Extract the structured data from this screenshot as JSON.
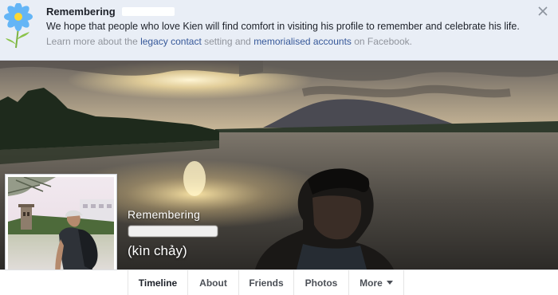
{
  "banner": {
    "title": "Remembering",
    "message": "We hope that people who love Kien will find comfort in visiting his profile to remember and celebrate his life.",
    "learn_prefix": "Learn more about the ",
    "legacy_link": "legacy contact",
    "learn_middle": " setting and ",
    "memorial_link": "memorialised accounts",
    "learn_suffix": " on Facebook.",
    "icon": "flower-icon",
    "close_icon": "close-icon"
  },
  "cover": {
    "remembering": "Remembering",
    "alt_name": "(kìn chảy)"
  },
  "tabs": [
    {
      "label": "Timeline"
    },
    {
      "label": "About"
    },
    {
      "label": "Friends"
    },
    {
      "label": "Photos"
    },
    {
      "label": "More"
    }
  ],
  "colors": {
    "link": "#365899",
    "banner_bg": "#e9eef6",
    "text": "#1d2129",
    "muted": "#90949c"
  }
}
